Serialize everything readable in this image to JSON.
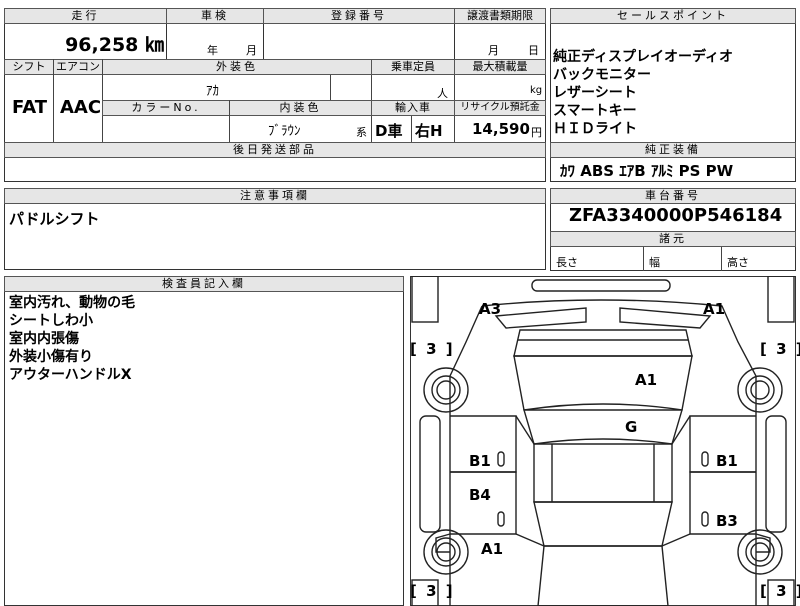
{
  "top_row": {
    "mileage_label": "走行",
    "inspection_label": "車検",
    "registration_label": "登録番号",
    "transfer_deadline_label": "譲渡書類期限",
    "mileage_value": "96,258 ㎞",
    "inspection_year_unit": "年",
    "inspection_month_unit": "月",
    "deadline_month_unit": "月",
    "deadline_day_unit": "日"
  },
  "spec_row": {
    "shift_label": "シフト",
    "aircon_label": "エアコン",
    "exterior_color_label": "外装色",
    "capacity_label": "乗車定員",
    "max_load_label": "最大積載量",
    "shift_value": "FAT",
    "aircon_value": "AAC",
    "exterior_color_value": "ｱｶ",
    "capacity_unit": "人",
    "load_unit": "kg",
    "color_no_label": "カラーNo.",
    "interior_color_label": "内装色",
    "import_label": "輸入車",
    "recycle_label": "リサイクル預託金",
    "interior_color_value": "ﾌﾞﾗｳﾝ",
    "interior_suffix": "系",
    "import_dealer": "D車",
    "steering": "右H",
    "recycle_amount": "14,590",
    "recycle_unit": "円",
    "later_parts_label": "後日発送部品"
  },
  "sales_points": {
    "header": "セールスポイント",
    "items": [
      "純正ディスプレイオーディオ",
      "バックモニター",
      "レザーシート",
      "スマートキー",
      "ＨＩＤライト"
    ]
  },
  "genuine_equipment": {
    "header": "純正装備",
    "value": "ｶﾜ ABS ｴｱB ｱﾙﾐ PS PW"
  },
  "notes": {
    "header": "注意事項欄",
    "value": "パドルシフト"
  },
  "chassis": {
    "header": "車台番号",
    "value": "ZFA3340000P546184"
  },
  "dimensions": {
    "header": "諸元",
    "length_label": "長さ",
    "width_label": "幅",
    "height_label": "高さ"
  },
  "inspector": {
    "header": "検査員記入欄",
    "lines": [
      "室内汚れ、動物の毛",
      "シートしわ小",
      "室内内張傷",
      "外装小傷有り",
      "アウターハンドルX"
    ]
  },
  "car_diagram": {
    "marks": {
      "rear_left": "A3",
      "rear_right": "A1",
      "trunk": "A1",
      "rear_glass": "G",
      "rear_door_left": "B1",
      "rear_door_right": "B1",
      "front_door_left": "B4",
      "front_door_right": "B3",
      "front_fender_left": "A1"
    },
    "tire_rear_left": "3",
    "tire_rear_right": "3",
    "tire_front_left": "3",
    "tire_front_right": "3"
  }
}
